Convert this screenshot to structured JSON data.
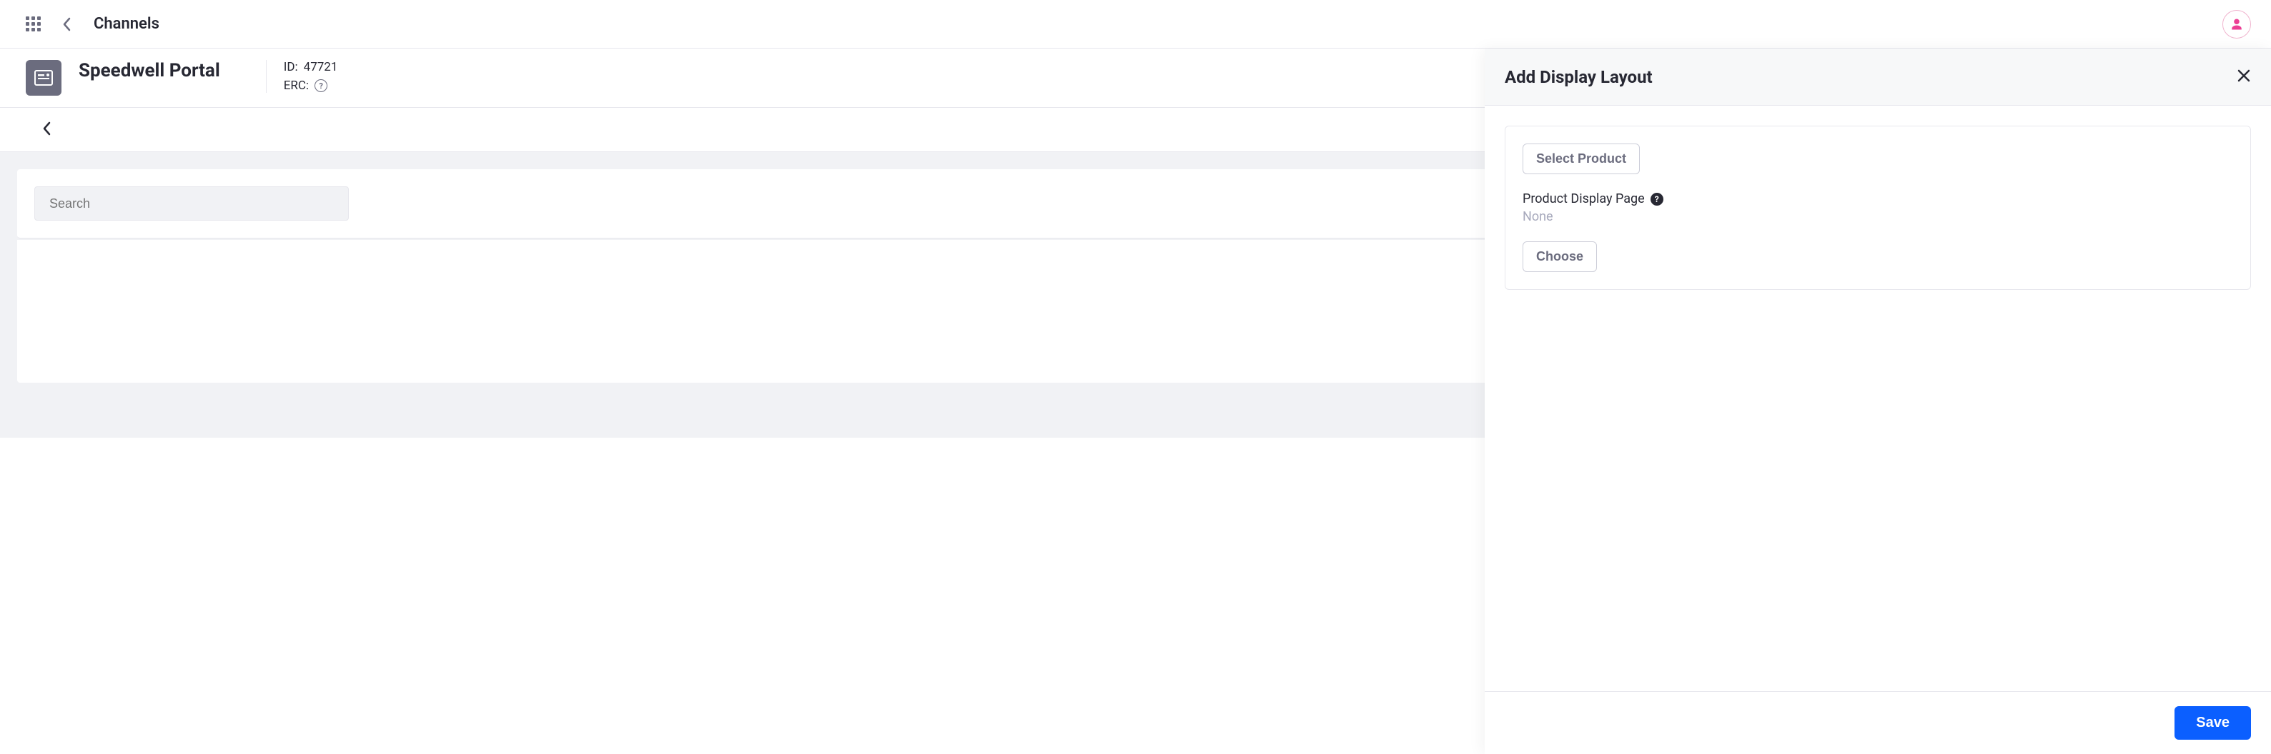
{
  "header": {
    "breadcrumb": "Channels"
  },
  "page": {
    "title": "Speedwell Portal",
    "id_label": "ID:",
    "id_value": "47721",
    "erc_label": "ERC:"
  },
  "search": {
    "placeholder": "Search"
  },
  "panel": {
    "title": "Add Display Layout",
    "select_product_label": "Select Product",
    "display_page_label": "Product Display Page",
    "display_page_value": "None",
    "choose_label": "Choose",
    "save_label": "Save"
  }
}
